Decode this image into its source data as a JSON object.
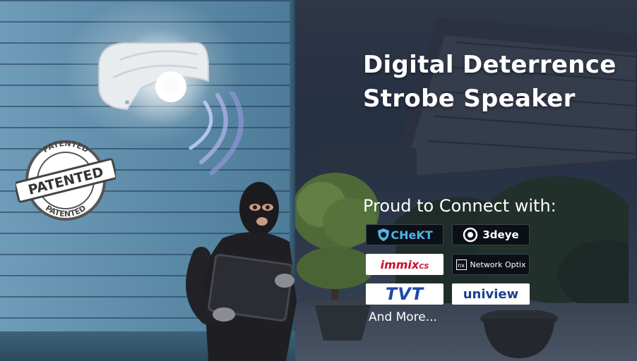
{
  "headline": {
    "line1": "Digital Deterrence",
    "line2": "Strobe Speaker"
  },
  "stamp": {
    "text": "PATENTED"
  },
  "partners": {
    "heading": "Proud to Connect with:",
    "logos": [
      {
        "name": "CHeKT",
        "text": "CHeKT"
      },
      {
        "name": "3deye",
        "text": "3deye"
      },
      {
        "name": "immix CS",
        "text": "immix",
        "suffix": "CS"
      },
      {
        "name": "Network Optix",
        "text": "Network Optix",
        "mark": "nx"
      },
      {
        "name": "TVT",
        "text": "TVT"
      },
      {
        "name": "uniview",
        "text": "uniview"
      }
    ],
    "more": "And More..."
  },
  "colors": {
    "headline": "#ffffff",
    "wall": "#5c8ba8",
    "immix_red": "#c8102e",
    "tvt_blue": "#1e4aa8",
    "uniview_blue": "#1b3f8f",
    "chekt_blue": "#4fb3e6"
  },
  "icons": [
    "strobe-speaker-device-icon",
    "sound-wave-icon",
    "patented-stamp-icon",
    "chekt-shield-icon",
    "3deye-ring-icon",
    "nx-box-icon"
  ]
}
